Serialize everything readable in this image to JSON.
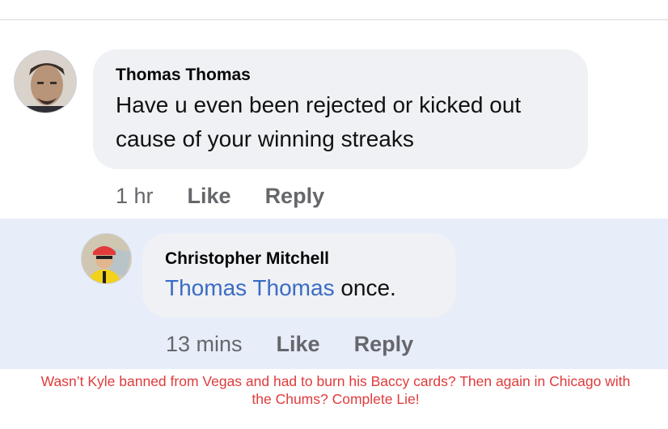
{
  "comment": {
    "author": "Thomas Thomas",
    "text_line1": "Have u even been rejected or kicked out",
    "text_line2": "cause of your winning streaks",
    "time": "1 hr",
    "like_label": "Like",
    "reply_label": "Reply"
  },
  "reply": {
    "author": "Christopher Mitchell",
    "mention": "Thomas Thomas",
    "text": " once.",
    "time": "13 mins",
    "like_label": "Like",
    "reply_label": "Reply"
  },
  "caption": "Wasn’t Kyle banned from Vegas and had to burn his Baccy cards? Then again in Chicago with the Chums? Complete Lie!",
  "colors": {
    "mention": "#3b6cc4",
    "caption": "#e03b3b",
    "reply_highlight": "#e8edfa",
    "bubble": "#eff1f4"
  }
}
